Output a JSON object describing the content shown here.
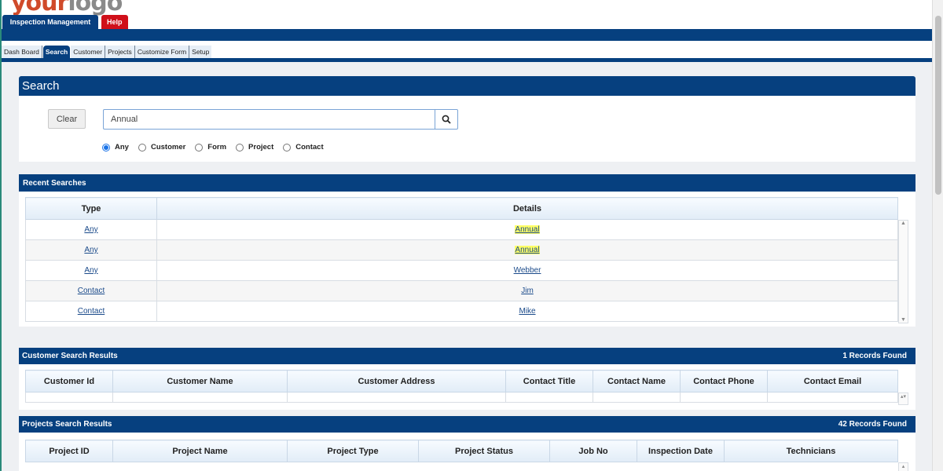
{
  "header": {
    "logo_text": "your",
    "logo_text2": "logo",
    "main_tab": "Inspection Management",
    "help_tab": "Help"
  },
  "subnav": [
    "Dash Board",
    "Search",
    "Customer",
    "Projects",
    "Customize Form",
    "Setup"
  ],
  "search": {
    "title": "Search",
    "clear_label": "Clear",
    "query": "Annual",
    "options": [
      "Any",
      "Customer",
      "Form",
      "Project",
      "Contact"
    ],
    "selected": "Any"
  },
  "recent": {
    "title": "Recent Searches",
    "columns": [
      "Type",
      "Details"
    ],
    "rows": [
      {
        "type": "Any",
        "details": "Annual"
      },
      {
        "type": "Any",
        "details": "Annual"
      },
      {
        "type": "Any",
        "details": "Webber"
      },
      {
        "type": "Contact",
        "details": "Jim"
      },
      {
        "type": "Contact",
        "details": "Mike"
      }
    ]
  },
  "customer_results": {
    "title": "Customer Search Results",
    "count": "1 Records Found",
    "columns": [
      "Customer Id",
      "Customer Name",
      "Customer Address",
      "Contact Title",
      "Contact Name",
      "Contact Phone",
      "Contact Email"
    ]
  },
  "project_results": {
    "title": "Projects Search Results",
    "count": "42 Records Found",
    "columns": [
      "Project ID",
      "Project Name",
      "Project Type",
      "Project Status",
      "Job No",
      "Inspection Date",
      "Technicians"
    ]
  },
  "colors": {
    "brand_blue": "#06407f",
    "help_red": "#d0101a",
    "highlight": "#ffff66"
  }
}
